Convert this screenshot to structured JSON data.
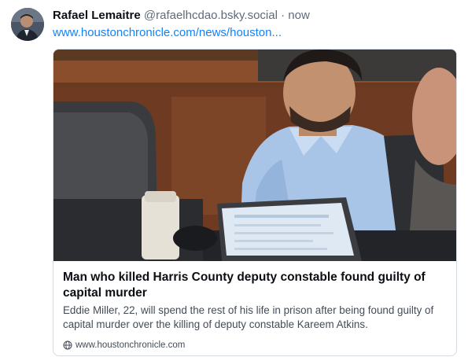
{
  "post": {
    "author": {
      "display_name": "Rafael Lemaitre",
      "handle": "@rafaelhcdao.bsky.social",
      "separator": "·",
      "timestamp": "now",
      "avatar_icon": "user-avatar"
    },
    "link_text": "www.houstonchronicle.com/news/houston...",
    "link_card": {
      "image_description_icon": "courtroom-photo",
      "title": "Man who killed Harris County deputy constable found guilty of capital murder",
      "description": "Eddie Miller, 22, will spend the rest of his life in prison after being found guilty of capital murder over the killing of deputy constable Kareem Atkins.",
      "source_icon": "globe-icon",
      "source_domain": "www.houstonchronicle.com"
    }
  },
  "colors": {
    "link": "#1083fe",
    "text_primary": "#0b0f14",
    "text_secondary": "#5f6b7a",
    "card_border": "#d4dbe2"
  }
}
